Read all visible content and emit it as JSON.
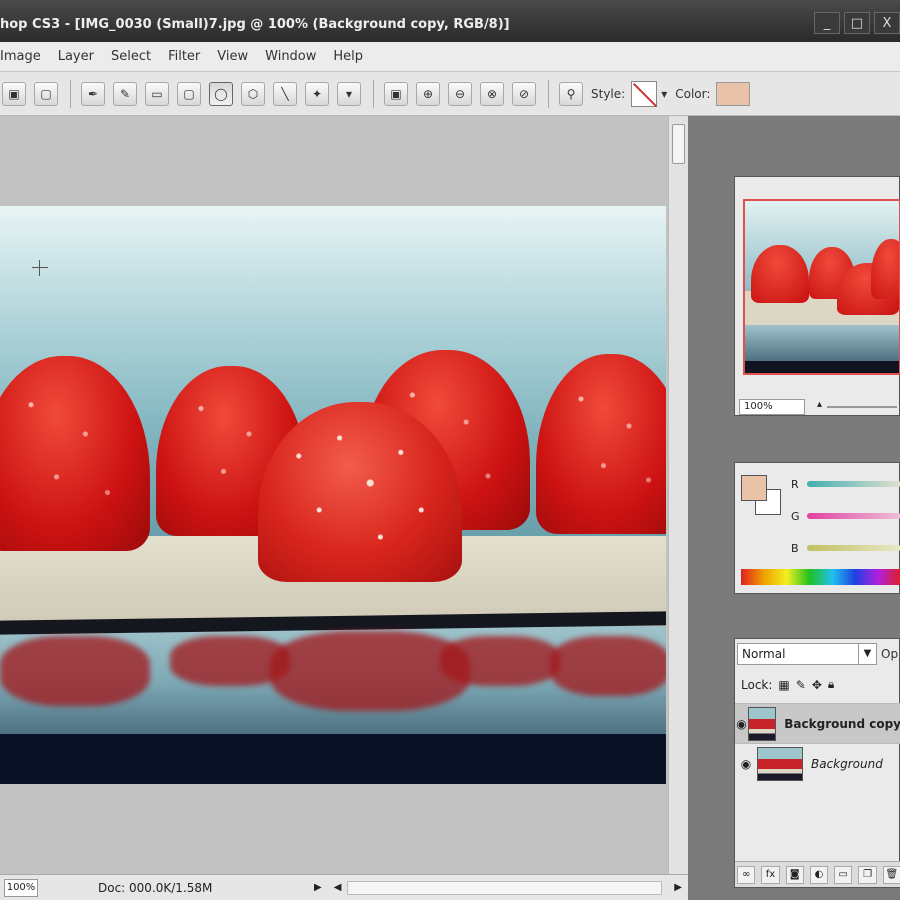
{
  "window": {
    "title": "hop CS3 - [IMG_0030 (Small)7.jpg @ 100% (Background copy, RGB/8)]",
    "buttons": [
      "_",
      "□",
      "X"
    ]
  },
  "menu": [
    "Image",
    "Layer",
    "Select",
    "Filter",
    "View",
    "Window",
    "Help"
  ],
  "options_bar": {
    "style_label": "Style:",
    "color_label": "Color:",
    "color_value": "#e8c3a8"
  },
  "status_bar": {
    "zoom": "100%",
    "doc": "Doc: 000.0K/1.58M"
  },
  "navigator": {
    "zoom": "100%"
  },
  "color_panel": {
    "foreground": "#e8c3a8",
    "background": "#ffffff",
    "channels": [
      "R",
      "G",
      "B"
    ]
  },
  "layers_panel": {
    "blend_mode": "Normal",
    "opacity_label": "Op",
    "lock_label": "Lock:",
    "layers": [
      {
        "name": "Background copy",
        "active": true
      },
      {
        "name": "Background",
        "active": false
      }
    ]
  }
}
